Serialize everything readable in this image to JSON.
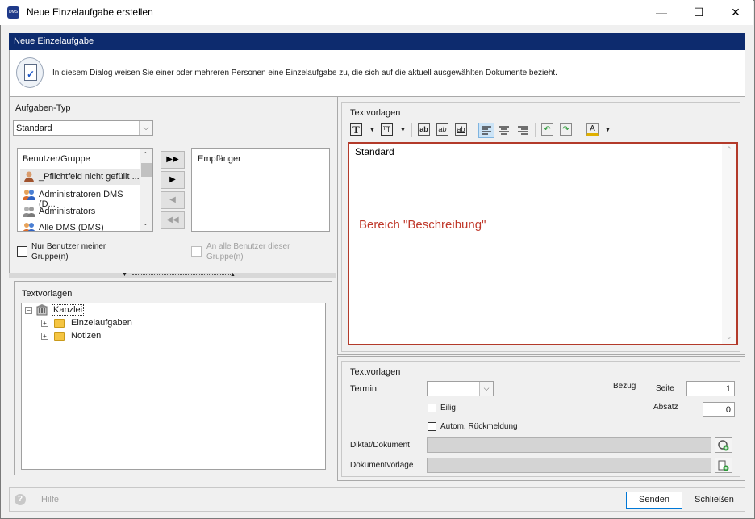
{
  "window": {
    "title": "Neue Einzelaufgabe erstellen",
    "app_icon_text": "DMS",
    "minimize": "—",
    "maximize": "☐",
    "close": "✕"
  },
  "header": {
    "title": "Neue Einzelaufgabe",
    "description": "In diesem Dialog weisen Sie einer oder mehreren Personen eine Einzelaufgabe zu, die sich auf die aktuell ausgewählten Dokumente bezieht."
  },
  "left": {
    "task_type_label": "Aufgaben-Typ",
    "task_type_value": "Standard",
    "users_header": "Benutzer/Gruppe",
    "users": [
      {
        "label": "_Pflichtfeld nicht gefüllt ...",
        "icon": "user-icon"
      },
      {
        "label": "Administratoren DMS (D...",
        "icon": "group-icon"
      },
      {
        "label": "Administrators",
        "icon": "group-gray-icon"
      },
      {
        "label": "Alle DMS (DMS)",
        "icon": "group-icon"
      }
    ],
    "recipients_header": "Empfänger",
    "move_buttons": [
      "▶▶",
      "▶",
      "◀",
      "◀◀"
    ],
    "chk_own_group": "Nur Benutzer meiner Gruppe(n)",
    "chk_all_users": "An alle Benutzer dieser Gruppe(n)",
    "templates_label": "Textvorlagen",
    "tree": {
      "root": "Kanzlei",
      "children": [
        "Einzelaufgaben",
        "Notizen"
      ]
    }
  },
  "right": {
    "templates_label": "Textvorlagen",
    "editor_text": "Standard",
    "editor_area_label": "Bereich \"Beschreibung\"",
    "toolbar": [
      "T",
      "ᵀT",
      "ab",
      "ab",
      "ab",
      "align-left",
      "align-center",
      "align-right",
      "undo",
      "redo",
      "A"
    ],
    "bottom": {
      "section_label": "Textvorlagen",
      "termin_label": "Termin",
      "termin_value": "",
      "urgent_label": "Eilig",
      "auto_reply_label": "Autom. Rückmeldung",
      "bezug_label": "Bezug",
      "seite_label": "Seite",
      "seite_value": "1",
      "absatz_label": "Absatz",
      "absatz_value": "0",
      "diktat_label": "Diktat/Dokument",
      "dokvorlage_label": "Dokumentvorlage"
    }
  },
  "footer": {
    "help": "Hilfe",
    "send": "Senden",
    "close": "Schließen"
  },
  "colors": {
    "header_bar": "#0d2b6e",
    "editor_border": "#b33a2a",
    "editor_area_text": "#c0392b"
  }
}
